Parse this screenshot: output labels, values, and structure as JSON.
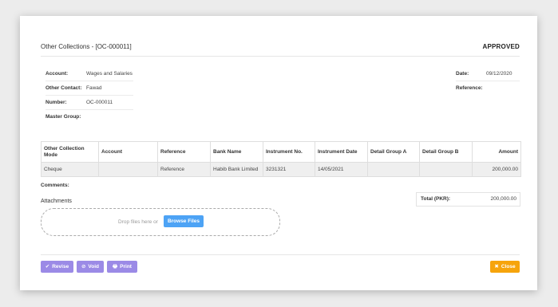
{
  "header": {
    "title": "Other Collections - [OC-000011]",
    "status": "APPROVED"
  },
  "fields": {
    "account_label": "Account:",
    "account_value": "Wages and Salaries",
    "other_contact_label": "Other Contact:",
    "other_contact_value": "Fawad",
    "number_label": "Number:",
    "number_value": "OC-000011",
    "master_group_label": "Master Group:",
    "date_label": "Date:",
    "date_value": "09/12/2020",
    "reference_label": "Reference:"
  },
  "table": {
    "columns": [
      "Other Collection Mode",
      "Account",
      "Reference",
      "Bank Name",
      "Instrument No.",
      "Instrument Date",
      "Detail Group A",
      "Detail Group B",
      "Amount"
    ],
    "rows": [
      [
        "Cheque",
        "",
        "Reference",
        "Habib Bank Limited",
        "3231321",
        "14/05/2021",
        "",
        "",
        "200,000.00"
      ]
    ]
  },
  "comments_label": "Comments:",
  "attachments": {
    "label": "Attachments",
    "drop_text": "Drop files here or",
    "browse_label": "Browse Files"
  },
  "total": {
    "label": "Total (PKR):",
    "value": "200,000.00"
  },
  "buttons": {
    "revise": "Revise",
    "void": "Void",
    "print": "Print",
    "close": "Close"
  },
  "colors": {
    "accent_purple": "#9b8ae6",
    "accent_orange": "#f6a40c",
    "browse_blue": "#4da3f5"
  }
}
